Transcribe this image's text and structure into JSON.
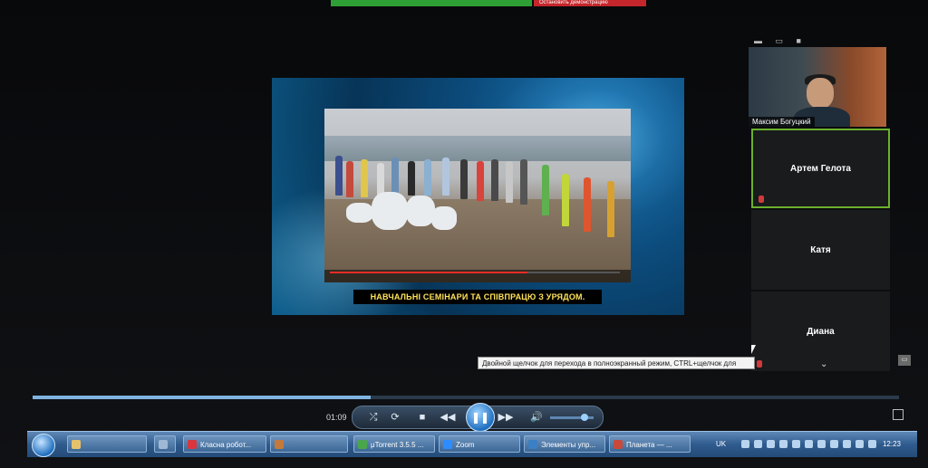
{
  "topbar": {
    "share_label": "",
    "stop_label": "Остановить демонстрацию",
    "accent_green": "#2e9f35",
    "accent_red": "#c5262b"
  },
  "video": {
    "caption": "НАВЧАЛЬНІ СЕМІНАРИ ТА СПІВПРАЦЮ З УРЯДОМ.",
    "progress_fraction": 0.68
  },
  "participants": {
    "controls": "▬ ▭ ■",
    "camera_name": "Максим Богуцкий",
    "tiles": [
      {
        "name": "Артем Гелота"
      },
      {
        "name": "Катя"
      },
      {
        "name": "Диана"
      }
    ]
  },
  "tooltip": "Двойной щелчок для перехода в полноэкранный режим, CTRL+щелчок для",
  "player": {
    "elapsed": "01:09",
    "seek_fraction": 0.39,
    "volume_fraction": 0.85
  },
  "taskbar": {
    "items": [
      {
        "label": "Класна робот...",
        "icon_color": "#d9363e"
      },
      {
        "label": "μTorrent 3.5.5 ...",
        "icon_color": "#4aa64a"
      },
      {
        "label": "Zoom",
        "icon_color": "#2d8cff"
      },
      {
        "label": "Элементы упр...",
        "icon_color": "#3b7fc4"
      },
      {
        "label": "Планета — ...",
        "icon_color": "#c94a3a"
      }
    ],
    "lang": "UK",
    "clock": "12:23"
  }
}
